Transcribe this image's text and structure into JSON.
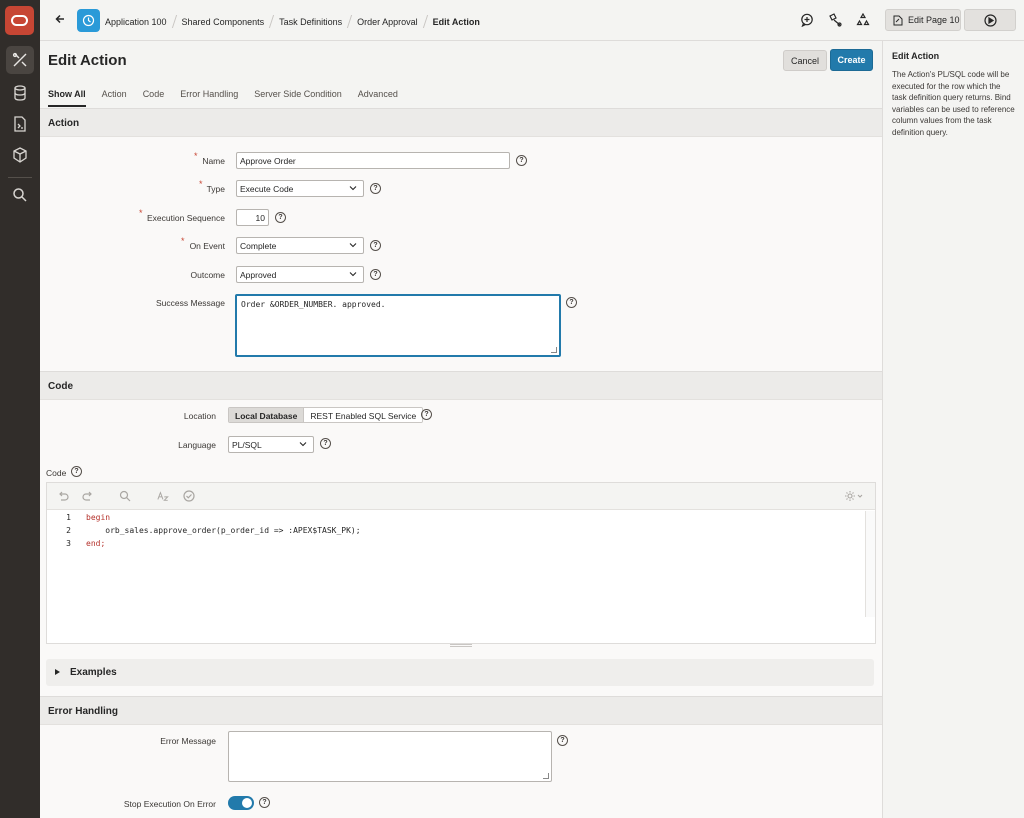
{
  "topbar": {
    "breadcrumbs": [
      "Application 100",
      "Shared Components",
      "Task Definitions",
      "Order Approval",
      "Edit Action"
    ],
    "edit_page_label": "Edit Page 10"
  },
  "page": {
    "title": "Edit Action",
    "cancel_label": "Cancel",
    "create_label": "Create",
    "tabs": [
      "Show All",
      "Action",
      "Code",
      "Error Handling",
      "Server Side Condition",
      "Advanced"
    ],
    "active_tab": "Show All"
  },
  "action_region": {
    "title": "Action",
    "name_label": "Name",
    "name_value": "Approve Order",
    "type_label": "Type",
    "type_value": "Execute Code",
    "seq_label": "Execution Sequence",
    "seq_value": "10",
    "event_label": "On Event",
    "event_value": "Complete",
    "outcome_label": "Outcome",
    "outcome_value": "Approved",
    "success_label": "Success Message",
    "success_value": "Order &ORDER_NUMBER. approved."
  },
  "code_region": {
    "title": "Code",
    "location_label": "Location",
    "location_options": [
      "Local Database",
      "REST Enabled SQL Service"
    ],
    "location_selected": "Local Database",
    "language_label": "Language",
    "language_value": "PL/SQL",
    "code_label": "Code",
    "line_numbers": [
      "1",
      "2",
      "3"
    ],
    "code_lines": [
      "begin",
      "    orb_sales.approve_order(p_order_id => :APEX$TASK_PK);",
      "end;"
    ],
    "examples_label": "Examples"
  },
  "error_region": {
    "title": "Error Handling",
    "error_message_label": "Error Message",
    "error_message_value": "",
    "stop_label": "Stop Execution On Error",
    "stop_value": true
  },
  "help_panel": {
    "title": "Edit Action",
    "text": "The Action's PL/SQL code will be executed for the row which the task definition query returns. Bind variables can be used to reference column values from the task definition query."
  },
  "colors": {
    "accent": "#227aab",
    "brand": "#c74634",
    "rail": "#312d2a"
  }
}
